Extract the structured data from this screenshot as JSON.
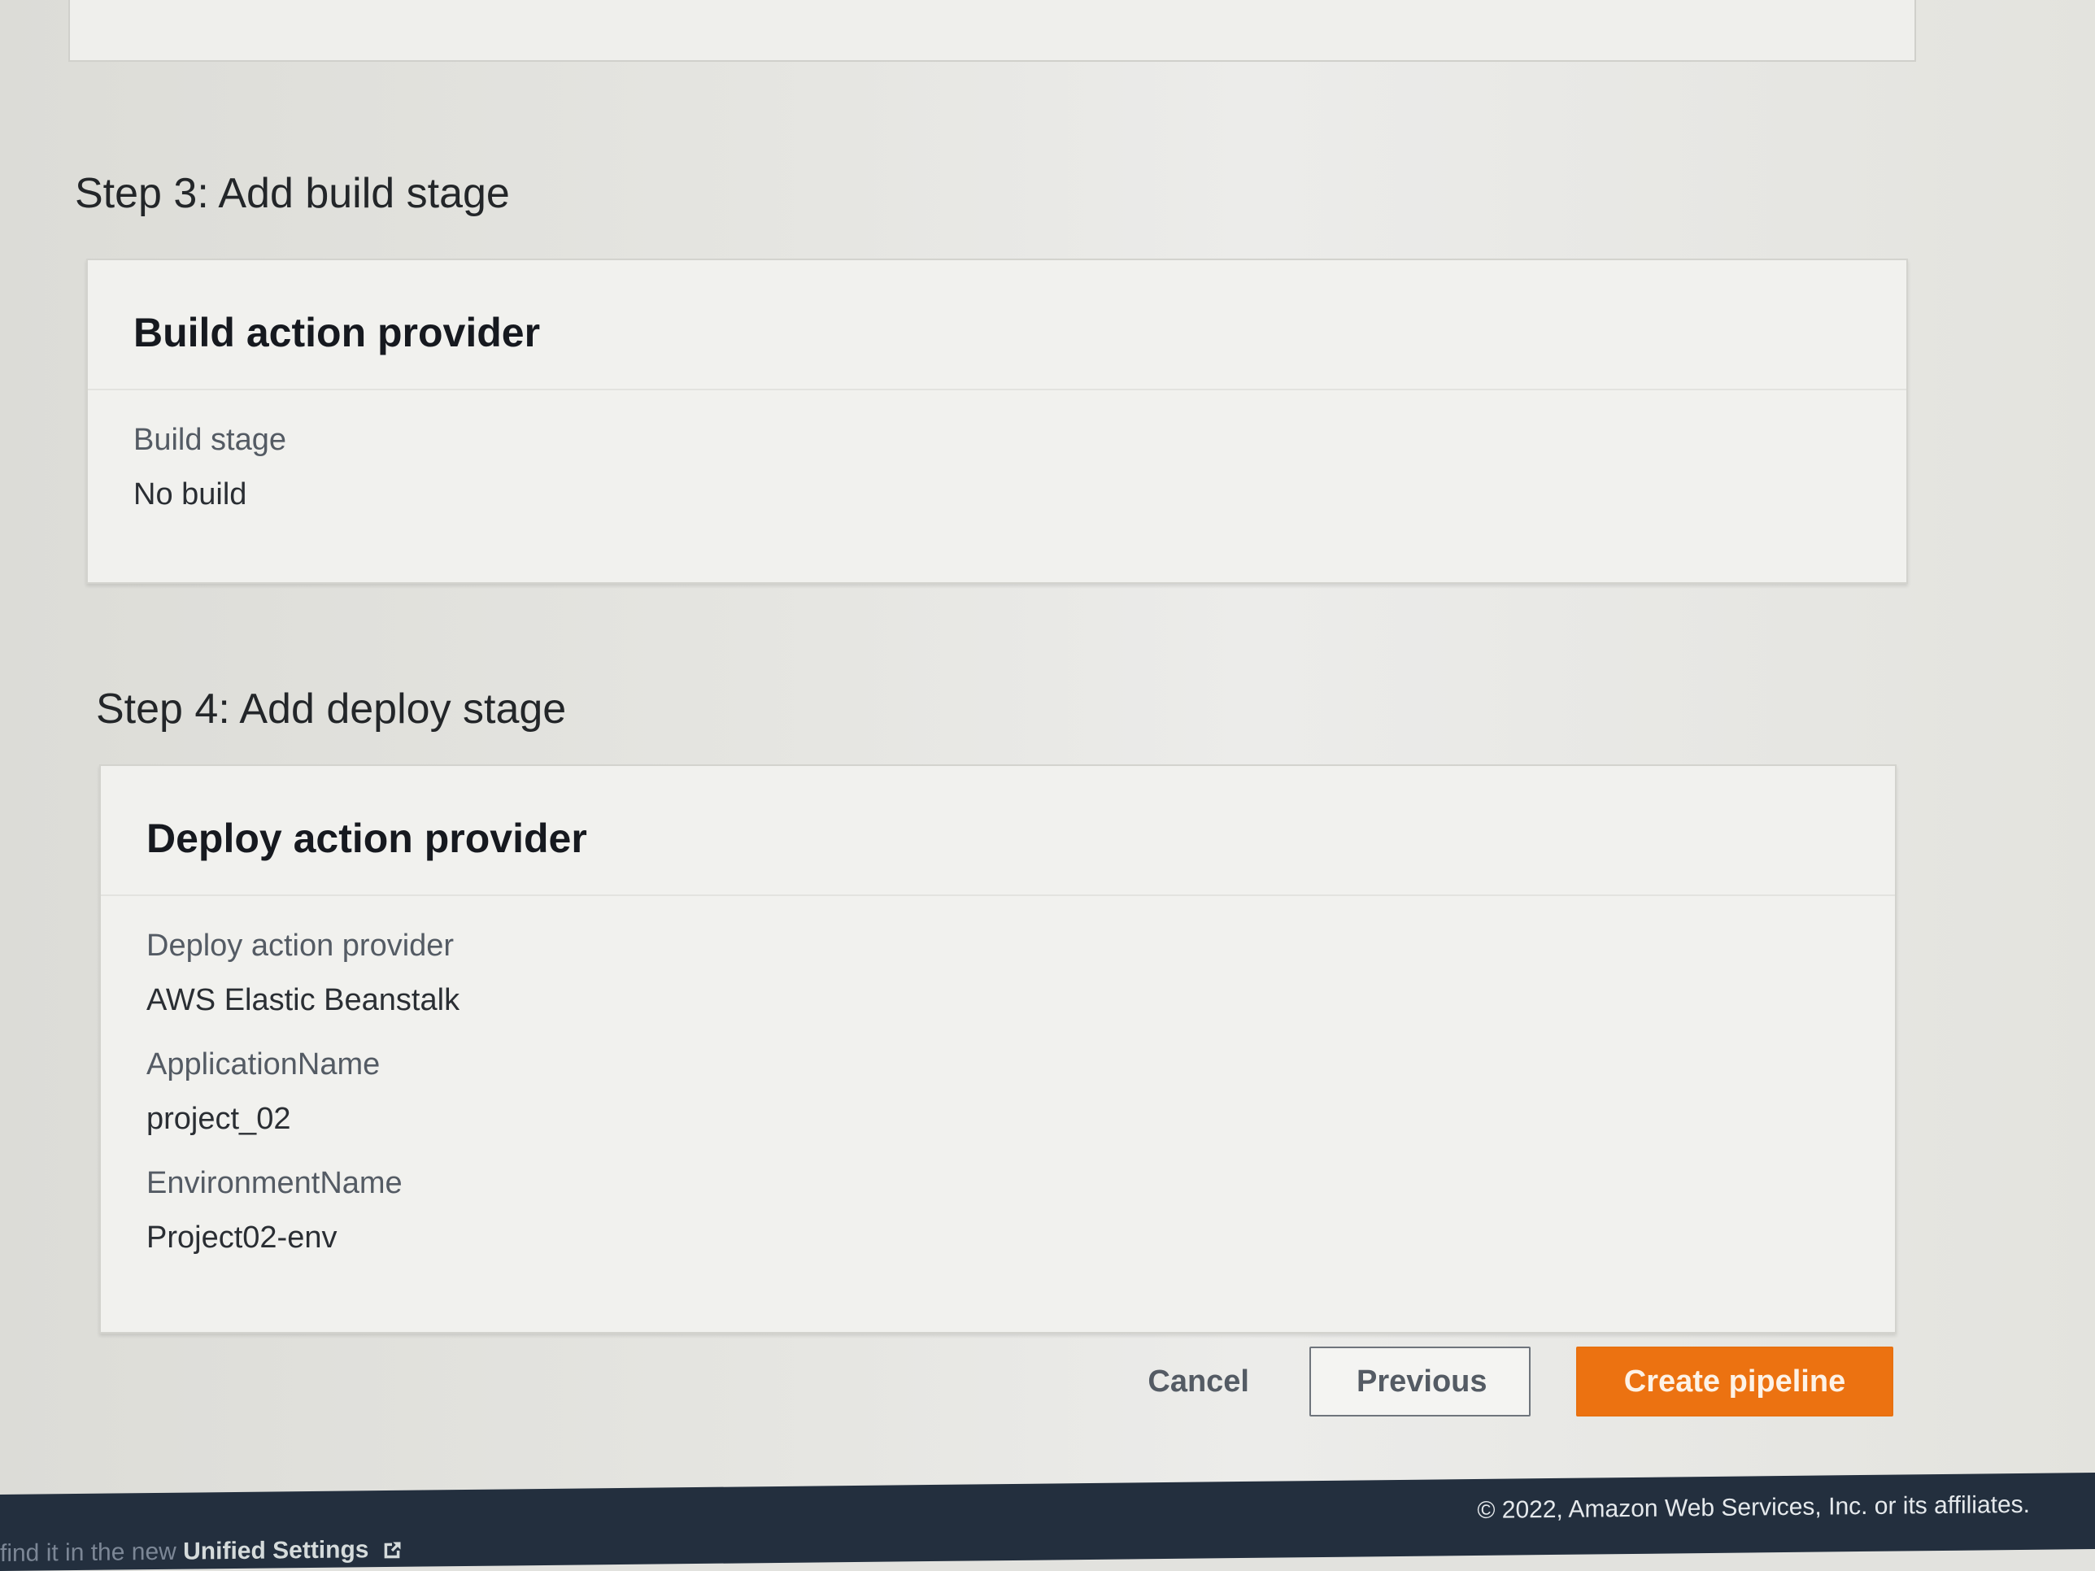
{
  "step3": {
    "heading": "Step 3: Add build stage",
    "card_title": "Build action provider",
    "fields": [
      {
        "label": "Build stage",
        "value": "No build"
      }
    ]
  },
  "step4": {
    "heading": "Step 4: Add deploy stage",
    "card_title": "Deploy action provider",
    "fields": [
      {
        "label": "Deploy action provider",
        "value": "AWS Elastic Beanstalk"
      },
      {
        "label": "ApplicationName",
        "value": "project_02"
      },
      {
        "label": "EnvironmentName",
        "value": "Project02-env"
      }
    ]
  },
  "actions": {
    "cancel": "Cancel",
    "previous": "Previous",
    "create": "Create pipeline"
  },
  "footer": {
    "left_text": "find it in the new",
    "left_link": "Unified Settings",
    "copyright": "© 2022, Amazon Web Services, Inc. or its affiliates."
  },
  "colors": {
    "primary_button": "#ec7211",
    "footer_bg": "#232f3e"
  }
}
